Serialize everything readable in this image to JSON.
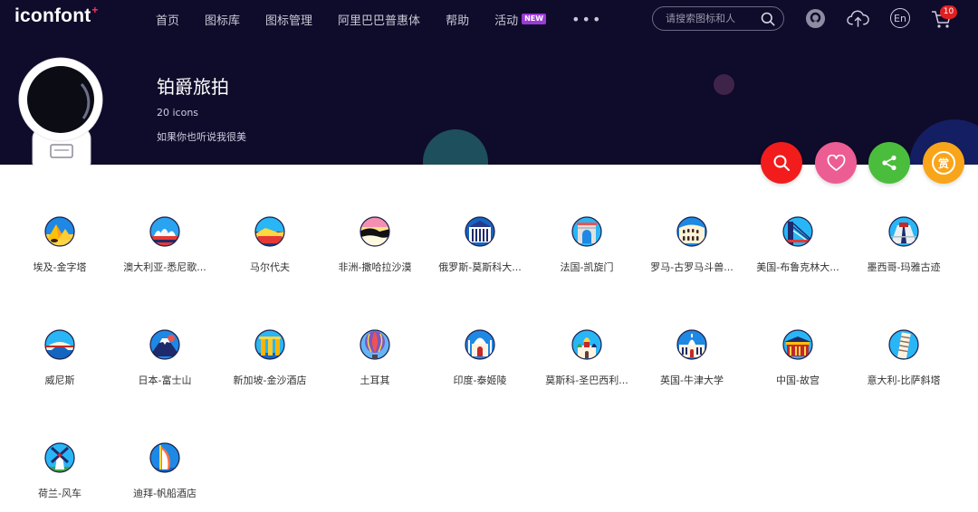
{
  "header": {
    "logo_text": "iconfont",
    "logo_plus": "+",
    "nav": [
      {
        "label": "首页"
      },
      {
        "label": "图标库"
      },
      {
        "label": "图标管理"
      },
      {
        "label": "阿里巴巴普惠体"
      },
      {
        "label": "帮助"
      },
      {
        "label": "活动",
        "badge": "NEW"
      }
    ],
    "more": "•••",
    "search_placeholder": "请搜索图标和人",
    "lang_label": "En",
    "cart_count": "10",
    "icons": [
      "github-icon",
      "upload-icon",
      "language-icon",
      "cart-icon"
    ]
  },
  "collection": {
    "title": "铂爵旅拍",
    "count_text": "20 icons",
    "description": "如果你也听说我很美"
  },
  "actions": [
    {
      "name": "search",
      "icon": "search-icon",
      "color": "#f21c1c"
    },
    {
      "name": "favorite",
      "icon": "heart-icon",
      "color": "#ec5d94"
    },
    {
      "name": "share",
      "icon": "share-icon",
      "color": "#4bbd3d"
    },
    {
      "name": "reward",
      "icon": "reward-icon",
      "label": "赏",
      "color": "#f9a51a"
    }
  ],
  "icons": [
    {
      "label": "埃及-金字塔"
    },
    {
      "label": "澳大利亚-悉尼歌..."
    },
    {
      "label": "马尔代夫"
    },
    {
      "label": "非洲-撒哈拉沙漠"
    },
    {
      "label": "俄罗斯-莫斯科大..."
    },
    {
      "label": "法国-凯旋门"
    },
    {
      "label": "罗马-古罗马斗兽..."
    },
    {
      "label": "美国-布鲁克林大..."
    },
    {
      "label": "墨西哥-玛雅古迹"
    },
    {
      "label": "威尼斯"
    },
    {
      "label": "日本-富士山"
    },
    {
      "label": "新加坡-金沙酒店"
    },
    {
      "label": "土耳其"
    },
    {
      "label": "印度-泰姬陵"
    },
    {
      "label": "莫斯科-圣巴西利..."
    },
    {
      "label": "英国-牛津大学"
    },
    {
      "label": "中国-故宫"
    },
    {
      "label": "意大利-比萨斜塔"
    },
    {
      "label": "荷兰-风车"
    },
    {
      "label": "迪拜-帆船酒店"
    }
  ]
}
